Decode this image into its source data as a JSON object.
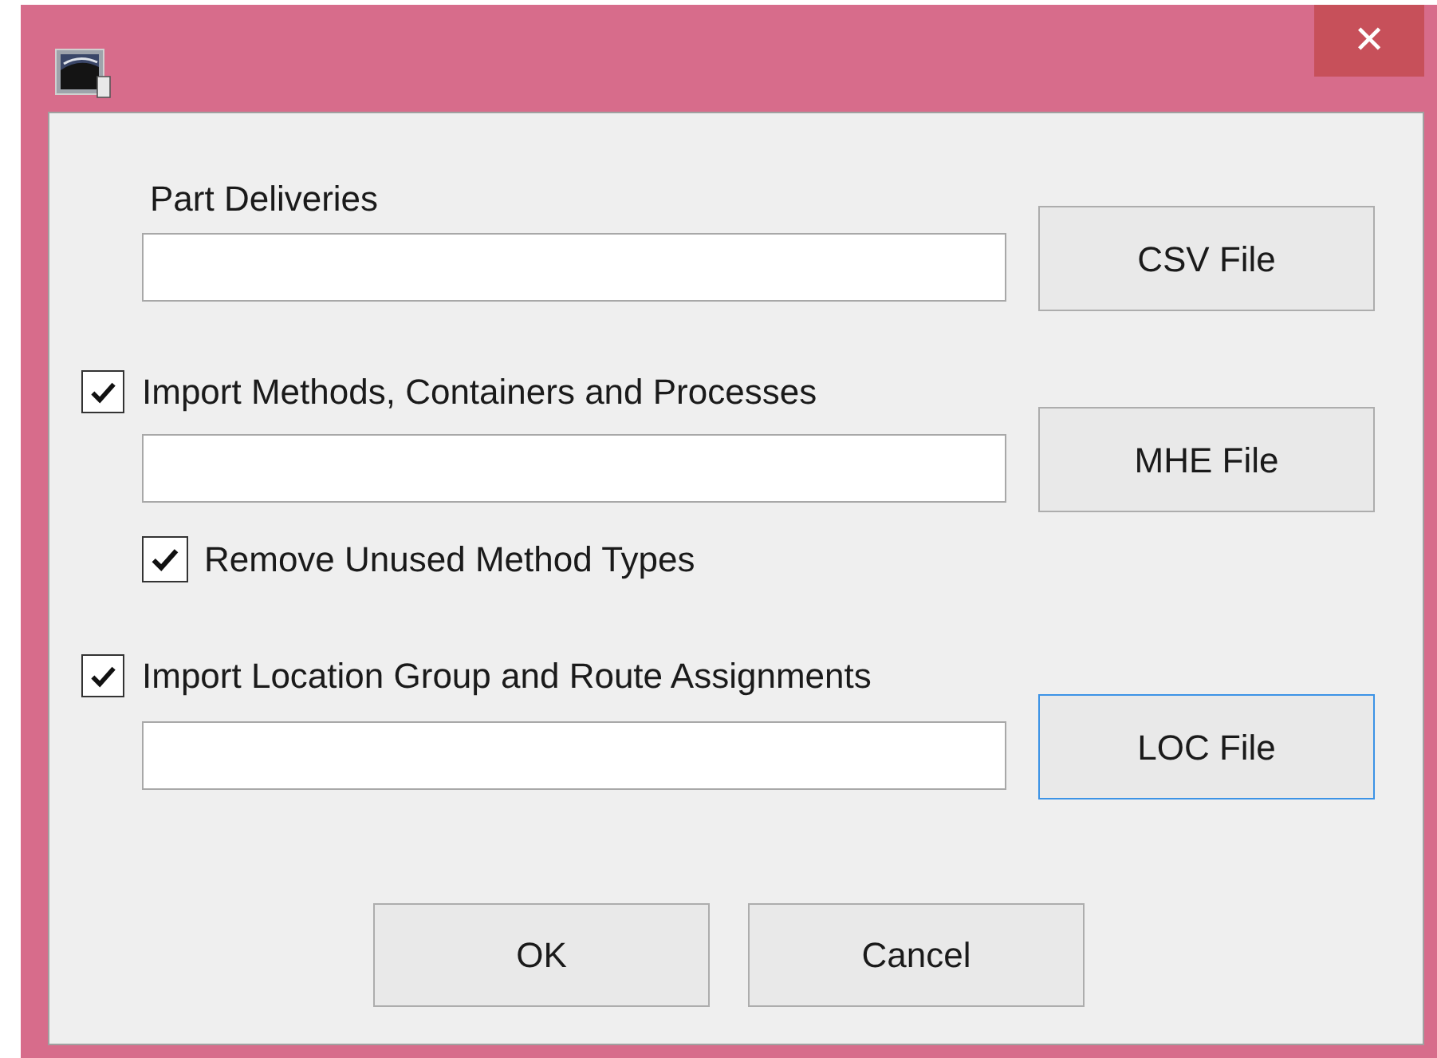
{
  "window": {
    "close_glyph": "✕"
  },
  "imports": [
    {
      "kind": "label",
      "label": "Part Deliveries",
      "button": {
        "label": "CSV File",
        "focused": false
      }
    },
    {
      "kind": "checkbox",
      "label": "Import Methods, Containers and Processes",
      "checked": true,
      "button": {
        "label": "MHE File",
        "focused": false
      },
      "options": [
        {
          "label": "Remove Unused Method Types",
          "checked": true
        }
      ]
    },
    {
      "kind": "checkbox",
      "label": "Import Location Group and Route Assignments",
      "checked": true,
      "button": {
        "label": "LOC File",
        "focused": true
      }
    }
  ],
  "buttons": [
    {
      "label": "OK"
    },
    {
      "label": "Cancel"
    }
  ]
}
